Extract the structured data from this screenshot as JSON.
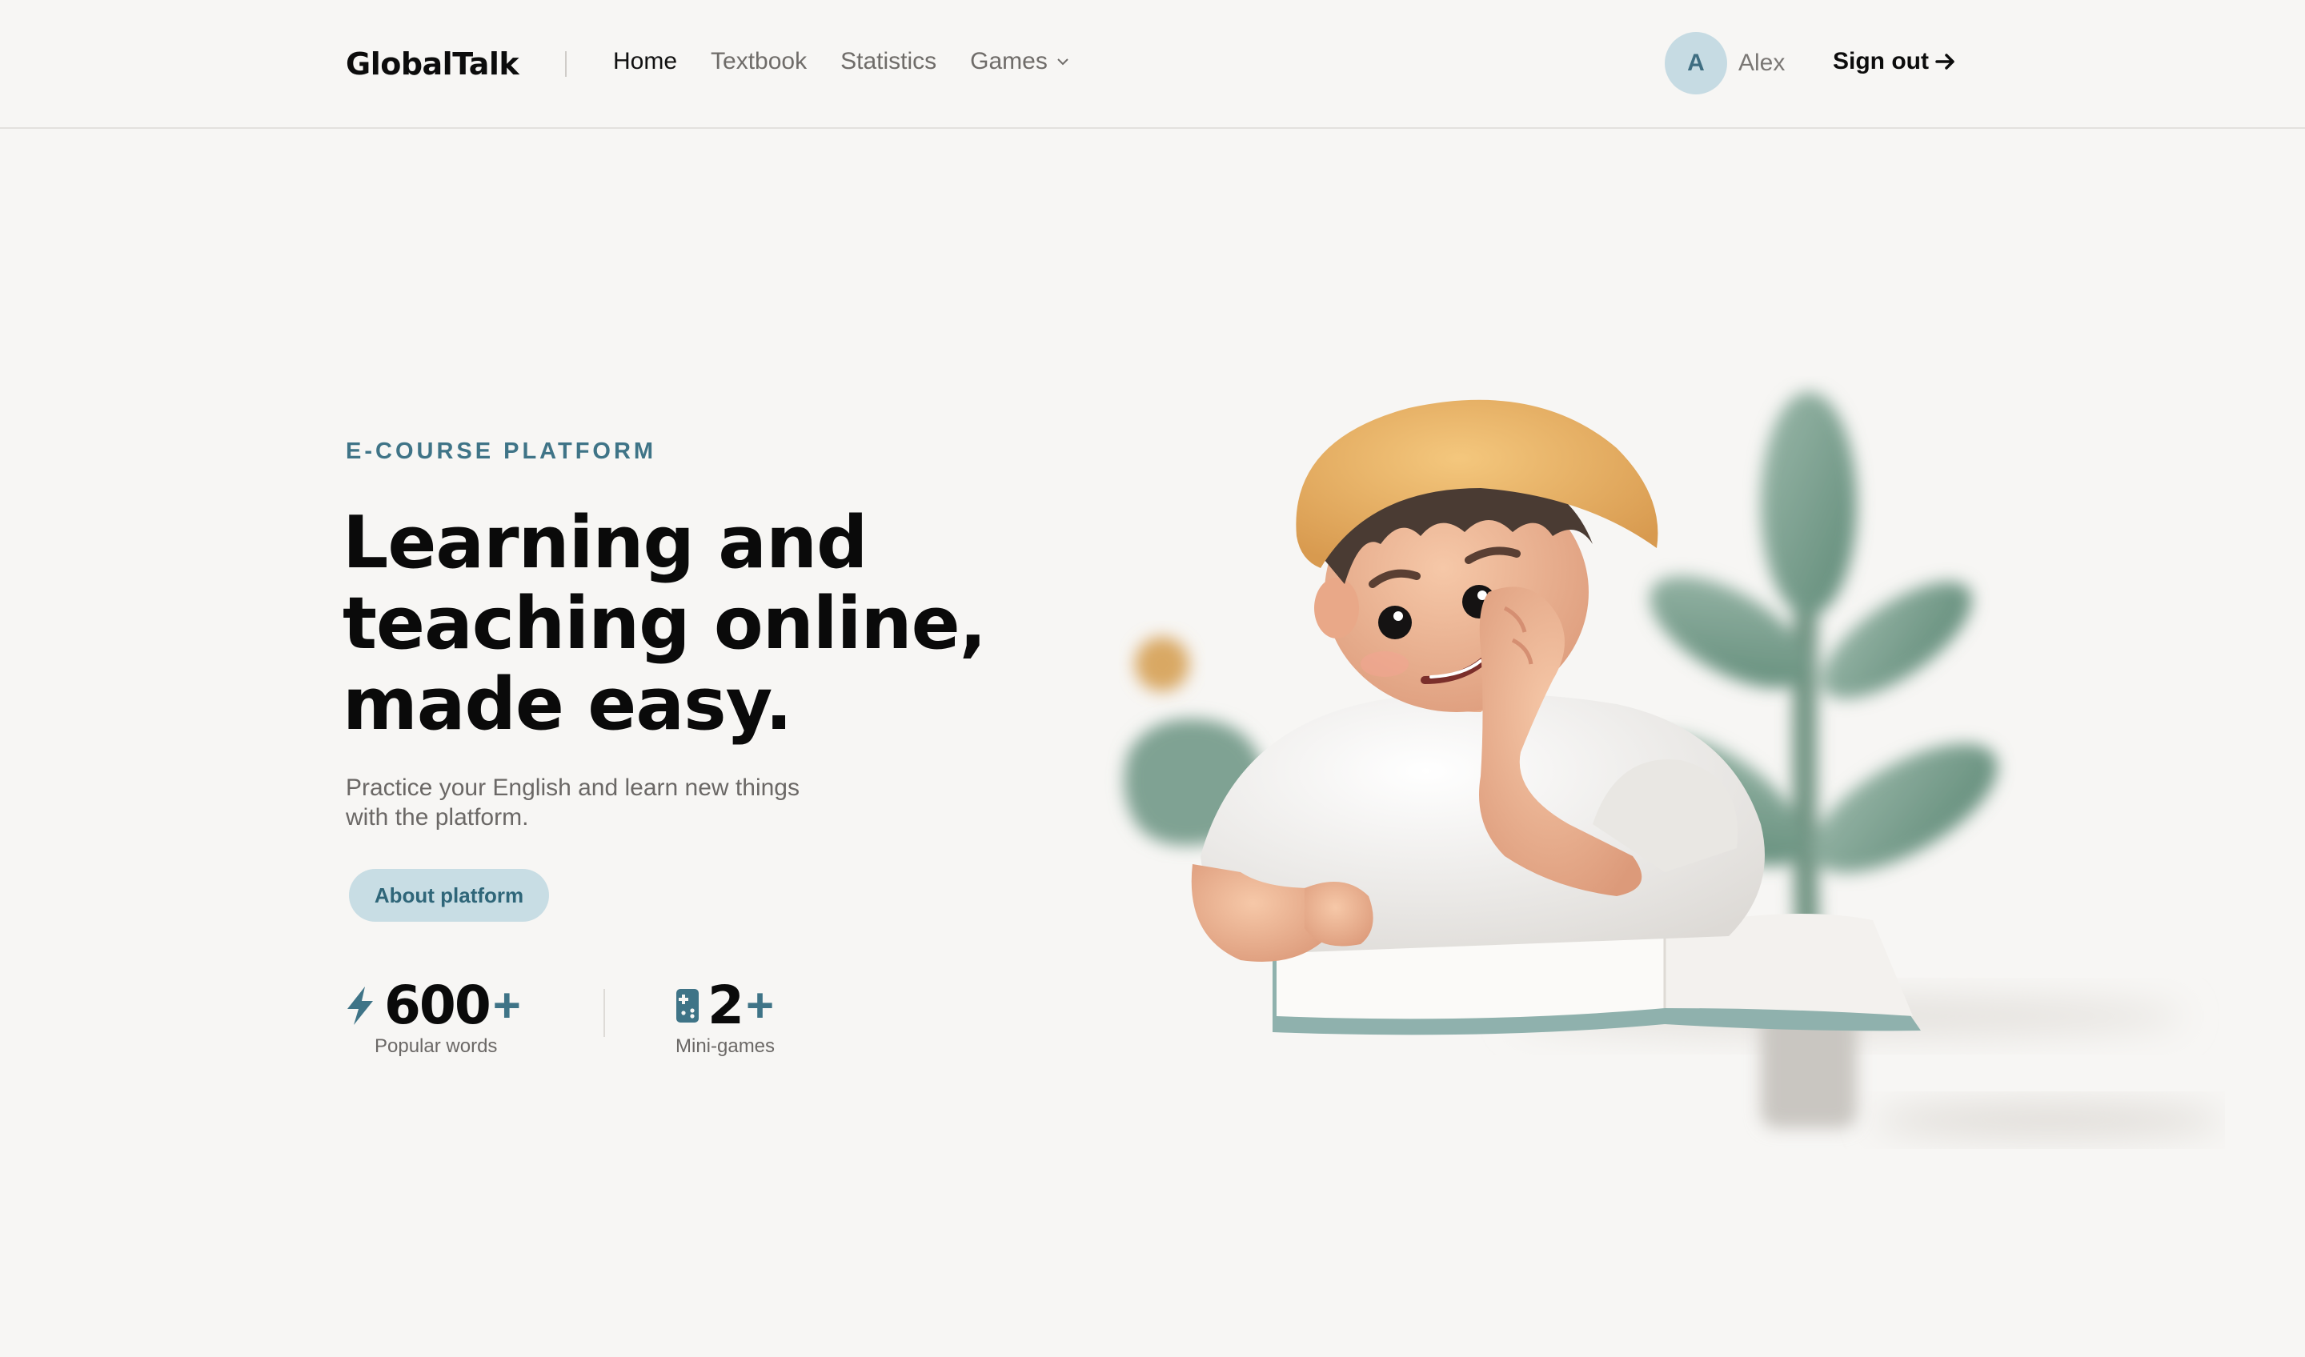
{
  "header": {
    "logo": "GlobalTalk",
    "nav": [
      {
        "label": "Home",
        "active": true
      },
      {
        "label": "Textbook",
        "active": false
      },
      {
        "label": "Statistics",
        "active": false
      },
      {
        "label": "Games",
        "active": false,
        "has_dropdown": true
      }
    ],
    "user": {
      "initial": "A",
      "name": "Alex"
    },
    "sign_out": "Sign out"
  },
  "hero": {
    "eyebrow": "E-COURSE PLATFORM",
    "headline": [
      "Learning and",
      "teaching online,",
      "made easy."
    ],
    "subtitle": [
      "Practice your English and learn new things",
      "with the platform."
    ],
    "cta": "About platform",
    "stats": [
      {
        "value": "600",
        "suffix": "+",
        "label": "Popular words",
        "icon": "lightning-icon"
      },
      {
        "value": "2",
        "suffix": "+",
        "label": "Mini-games",
        "icon": "gamepad-icon"
      }
    ]
  },
  "colors": {
    "background": "#f7f6f4",
    "accent": "#3f7487",
    "accent_light": "#c8dde4",
    "text": "#0a0a0a",
    "muted": "#6b6866"
  }
}
